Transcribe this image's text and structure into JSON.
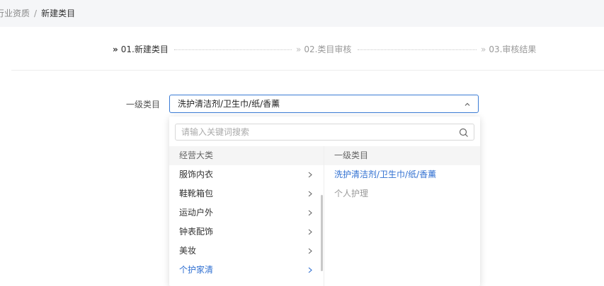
{
  "breadcrumb": {
    "parent": "行业资质",
    "separator": "/",
    "current": "新建类目"
  },
  "steps": [
    {
      "label": "01.新建类目"
    },
    {
      "label": "02.类目审核"
    },
    {
      "label": "03.审核结果"
    }
  ],
  "form": {
    "label": "一级类目",
    "selected_value": "洗护清洁剂/卫生巾/纸/香薰"
  },
  "dropdown": {
    "search_placeholder": "请输入关键词搜索",
    "left_header": "经营大类",
    "left_items": [
      {
        "label": "服饰内衣"
      },
      {
        "label": "鞋靴箱包"
      },
      {
        "label": "运动户外"
      },
      {
        "label": "钟表配饰"
      },
      {
        "label": "美妆"
      },
      {
        "label": "个护家清"
      }
    ],
    "right_header": "一级类目",
    "right_items": [
      {
        "label": "洗护清洁剂/卫生巾/纸/香薰"
      },
      {
        "label": "个人护理"
      }
    ]
  },
  "colors": {
    "accent": "#2f6fd1",
    "border_active": "#3a7bd5"
  }
}
